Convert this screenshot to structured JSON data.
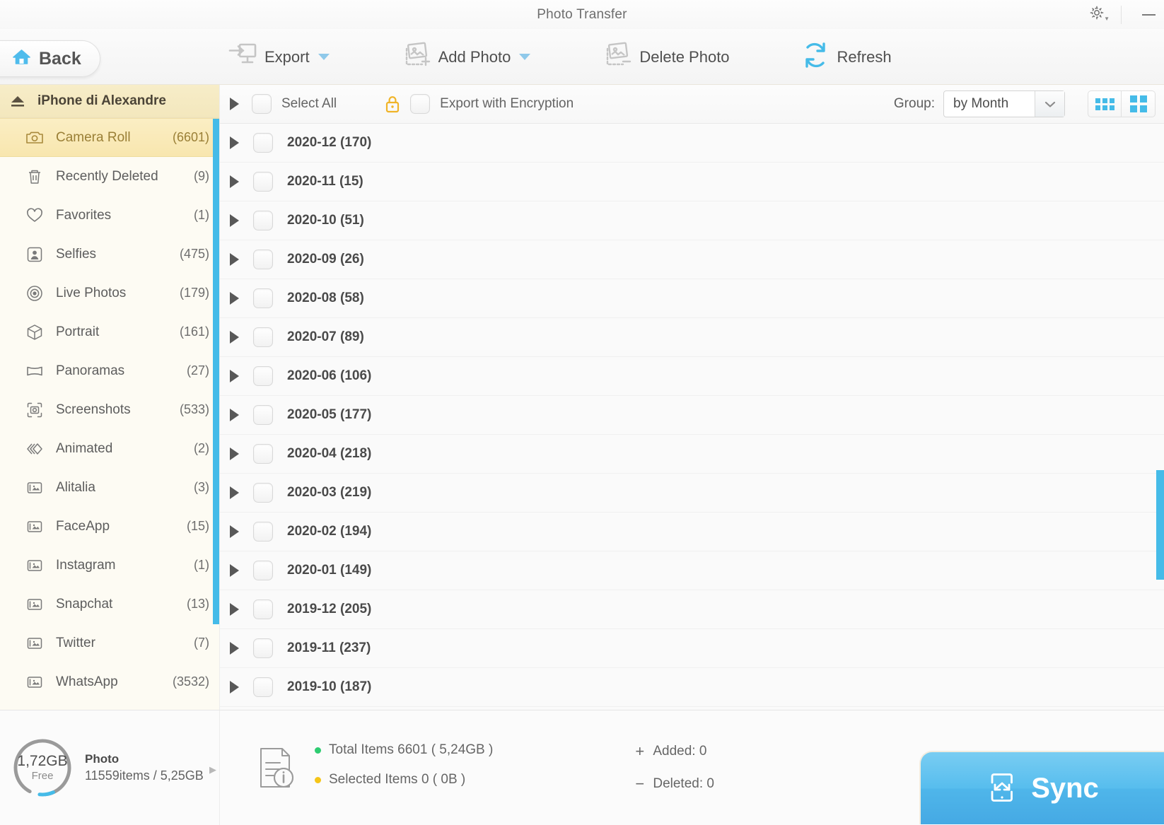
{
  "window": {
    "title": "Photo Transfer",
    "gear_icon": "gear-icon",
    "minimize_icon": "minimize-icon"
  },
  "toolbar": {
    "back_label": "Back",
    "back_icon": "home-icon",
    "items": [
      {
        "label": "Export",
        "icon": "export-icon",
        "has_caret": true
      },
      {
        "label": "Add Photo",
        "icon": "add-photo-icon",
        "has_caret": true
      },
      {
        "label": "Delete Photo",
        "icon": "delete-photo-icon",
        "has_caret": false
      },
      {
        "label": "Refresh",
        "icon": "refresh-icon",
        "has_caret": false
      }
    ]
  },
  "sidebar": {
    "device_name": "iPhone di Alexandre",
    "eject_icon": "eject-icon",
    "items": [
      {
        "label": "Camera Roll",
        "count": "(6601)",
        "icon": "camera-icon",
        "active": true
      },
      {
        "label": "Recently Deleted",
        "count": "(9)",
        "icon": "trash-icon",
        "active": false
      },
      {
        "label": "Favorites",
        "count": "(1)",
        "icon": "heart-icon",
        "active": false
      },
      {
        "label": "Selfies",
        "count": "(475)",
        "icon": "person-icon",
        "active": false
      },
      {
        "label": "Live Photos",
        "count": "(179)",
        "icon": "live-photo-icon",
        "active": false
      },
      {
        "label": "Portrait",
        "count": "(161)",
        "icon": "cube-icon",
        "active": false
      },
      {
        "label": "Panoramas",
        "count": "(27)",
        "icon": "panorama-icon",
        "active": false
      },
      {
        "label": "Screenshots",
        "count": "(533)",
        "icon": "screenshot-icon",
        "active": false
      },
      {
        "label": "Animated",
        "count": "(2)",
        "icon": "animated-icon",
        "active": false
      },
      {
        "label": "Alitalia",
        "count": "(3)",
        "icon": "album-icon",
        "active": false
      },
      {
        "label": "FaceApp",
        "count": "(15)",
        "icon": "album-icon",
        "active": false
      },
      {
        "label": "Instagram",
        "count": "(1)",
        "icon": "album-icon",
        "active": false
      },
      {
        "label": "Snapchat",
        "count": "(13)",
        "icon": "album-icon",
        "active": false
      },
      {
        "label": "Twitter",
        "count": "(7)",
        "icon": "album-icon",
        "active": false
      },
      {
        "label": "WhatsApp",
        "count": "(3532)",
        "icon": "album-icon",
        "active": false
      }
    ]
  },
  "content_header": {
    "select_all_label": "Select All",
    "encryption_label": "Export with Encryption",
    "lock_icon": "lock-icon",
    "group_label": "Group:",
    "group_value": "by Month",
    "view_grid_small_icon": "grid-small-icon",
    "view_grid_large_icon": "grid-large-icon"
  },
  "groups": [
    {
      "label": "2020-12 (170)"
    },
    {
      "label": "2020-11 (15)"
    },
    {
      "label": "2020-10 (51)"
    },
    {
      "label": "2020-09 (26)"
    },
    {
      "label": "2020-08 (58)"
    },
    {
      "label": "2020-07 (89)"
    },
    {
      "label": "2020-06 (106)"
    },
    {
      "label": "2020-05 (177)"
    },
    {
      "label": "2020-04 (218)"
    },
    {
      "label": "2020-03 (219)"
    },
    {
      "label": "2020-02 (194)"
    },
    {
      "label": "2020-01 (149)"
    },
    {
      "label": "2019-12 (205)"
    },
    {
      "label": "2019-11 (237)"
    },
    {
      "label": "2019-10 (187)"
    }
  ],
  "storage": {
    "free_value": "1,72GB",
    "free_label": "Free",
    "category": "Photo",
    "usage": "11559items / 5,25GB"
  },
  "status": {
    "info_icon": "document-info-icon",
    "total_items": "Total Items 6601  ( 5,24GB )",
    "selected_items": "Selected Items 0  ( 0B )",
    "added": "Added: 0",
    "deleted": "Deleted: 0",
    "added_sign": "+",
    "deleted_sign": "−",
    "total_dot_color": "#2ecc71",
    "selected_dot_color": "#f5c518"
  },
  "sync": {
    "label": "Sync",
    "icon": "sync-device-icon"
  },
  "colors": {
    "accent_blue": "#45bbe8",
    "highlight_yellow": "#f8e6ae",
    "sidebar_bg": "#fdfbf3"
  }
}
